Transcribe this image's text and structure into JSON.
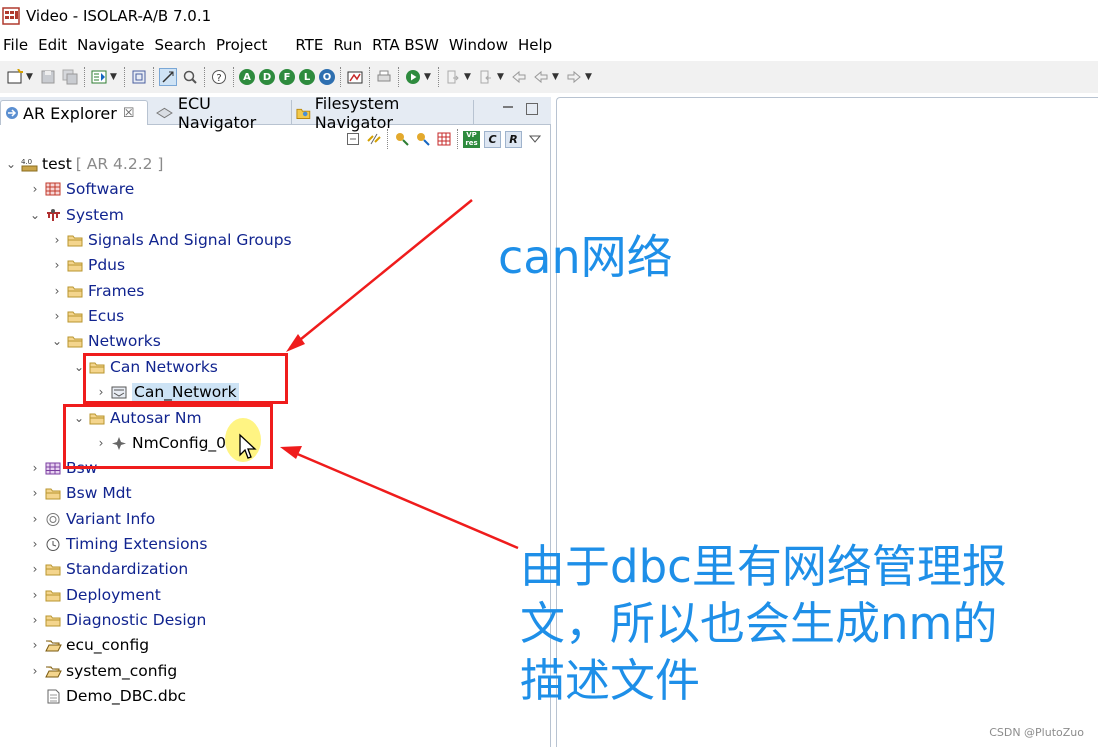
{
  "window": {
    "title": "Video - ISOLAR-A/B 7.0.1"
  },
  "menu": [
    "File",
    "Edit",
    "Navigate",
    "Search",
    "Project",
    "RTE",
    "Run",
    "RTA BSW",
    "Window",
    "Help"
  ],
  "tabs": [
    {
      "label": "AR Explorer",
      "close": "☒"
    },
    {
      "label": "ECU Navigator"
    },
    {
      "label": "Filesystem Navigator"
    }
  ],
  "toolbar_circles": [
    {
      "letter": "A",
      "color": "#2e8b3e"
    },
    {
      "letter": "D",
      "color": "#2e8b3e"
    },
    {
      "letter": "F",
      "color": "#2e8b3e"
    },
    {
      "letter": "L",
      "color": "#2e8b3e"
    },
    {
      "letter": "O",
      "color": "#2e6fb0"
    }
  ],
  "tree": {
    "root": {
      "label": "test",
      "version": "[ AR 4.2.2 ]"
    },
    "software": "Software",
    "system": "System",
    "system_children": [
      "Signals And Signal Groups",
      "Pdus",
      "Frames",
      "Ecus",
      "Networks"
    ],
    "can_networks": "Can Networks",
    "can_network": "Can_Network",
    "autosar_nm": "Autosar Nm",
    "nmconfig": "NmConfig_0",
    "bsw": "Bsw",
    "others": [
      "Bsw Mdt",
      "Variant Info",
      "Timing Extensions",
      "Standardization",
      "Deployment",
      "Diagnostic Design",
      "ecu_config",
      "system_config",
      "Demo_DBC.dbc"
    ]
  },
  "annotations": {
    "can_note": "can网络",
    "nm_note_lines": [
      "由于dbc里有网络管理报",
      "文，所以也会生成nm的",
      "描述文件"
    ]
  },
  "watermark": "CSDN @PlutoZuo",
  "colors": {
    "tree_text": "#11248f",
    "annotation": "#1e8fe8",
    "highlight_box": "#ef1c1c",
    "selection": "#cde3f5"
  }
}
